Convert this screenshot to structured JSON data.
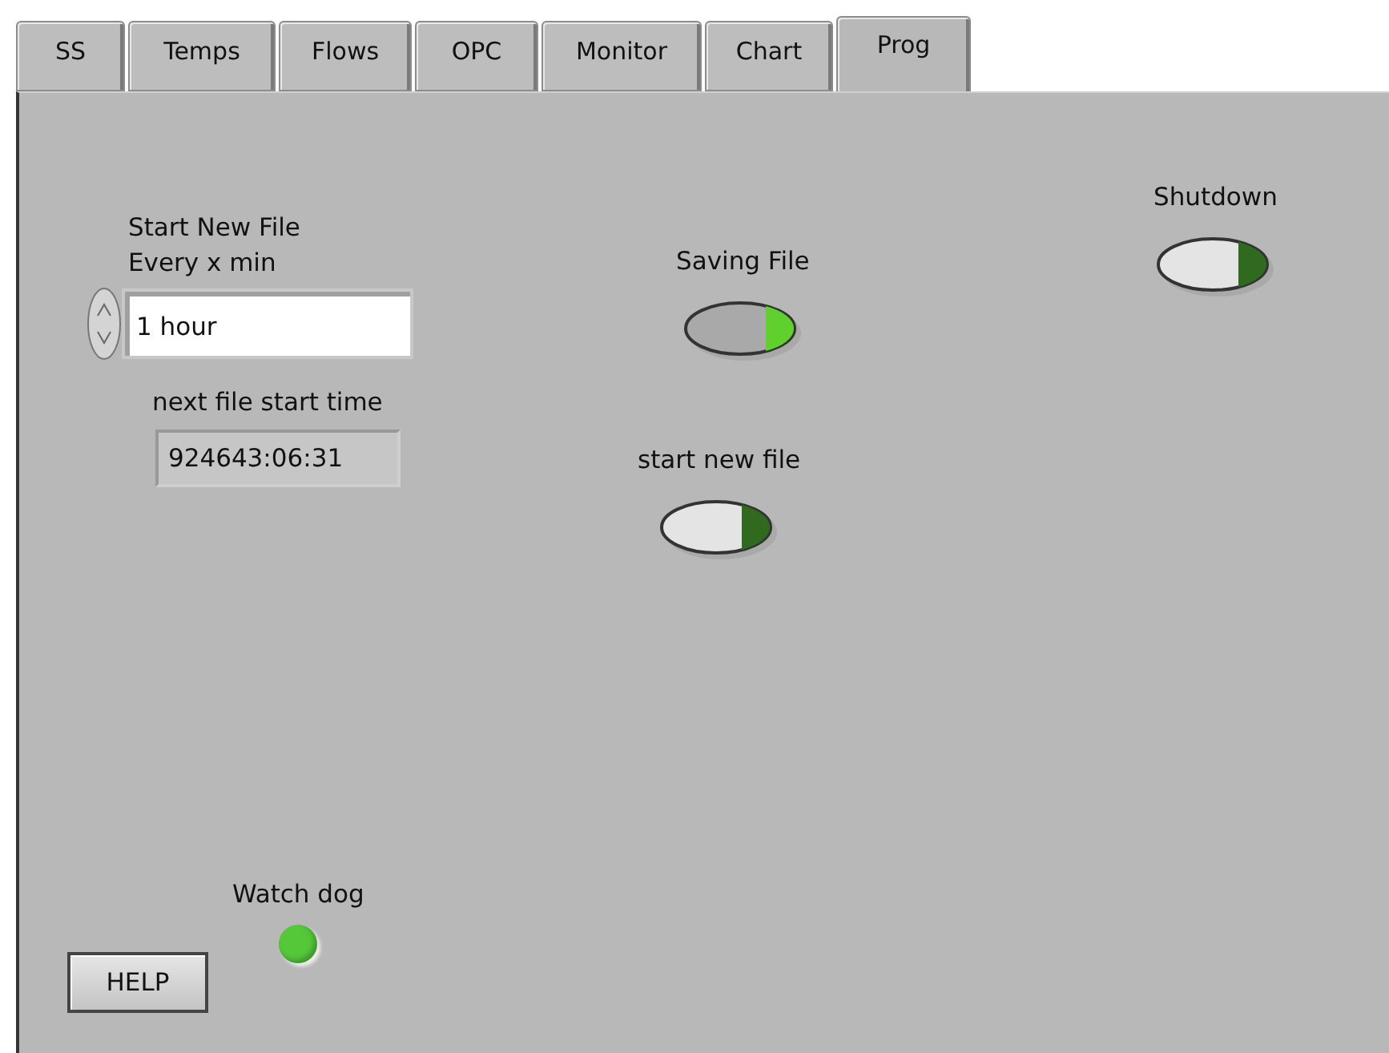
{
  "tabs": [
    {
      "label": "SS",
      "selected": false
    },
    {
      "label": "Temps",
      "selected": false
    },
    {
      "label": "Flows",
      "selected": false
    },
    {
      "label": "OPC",
      "selected": false
    },
    {
      "label": "Monitor",
      "selected": false
    },
    {
      "label": "Chart",
      "selected": false
    },
    {
      "label": "Prog",
      "selected": true
    }
  ],
  "controls": [
    {
      "kind": "numeric",
      "label": "Start New File\nEvery x min",
      "value": "1 hour"
    },
    {
      "kind": "indicator",
      "label": "next file start time",
      "value": "924643:06:31"
    },
    {
      "kind": "switch",
      "label": "Saving File",
      "on": true
    },
    {
      "kind": "switch",
      "label": "start new file",
      "on": false
    },
    {
      "kind": "switch",
      "label": "Shutdown",
      "on": false
    },
    {
      "kind": "led",
      "label": "Watch dog",
      "on": true
    },
    {
      "kind": "button",
      "label": "HELP"
    }
  ]
}
